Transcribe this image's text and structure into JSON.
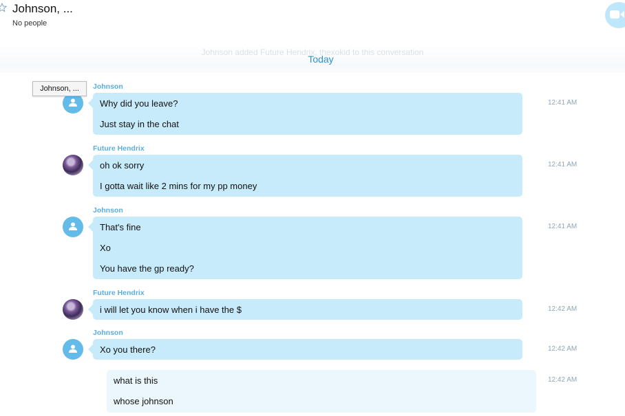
{
  "header": {
    "title": "Johnson, ...",
    "subtitle": "No people"
  },
  "system_note": "Johnson added Future Hendrix, thexokid to this conversation",
  "day_divider": "Today",
  "tooltip": "Johnson, ...",
  "messages": [
    {
      "sender": "Johnson",
      "time": "12:41 AM",
      "lines": [
        "Why did you leave?",
        "Just stay in the chat"
      ]
    },
    {
      "sender": "Future Hendrix",
      "time": "12:41 AM",
      "lines": [
        "oh ok sorry",
        "I gotta wait like 2 mins for my pp money"
      ]
    },
    {
      "sender": "Johnson",
      "time": "12:41 AM",
      "lines": [
        "That's fine",
        "Xo",
        "You have the gp ready?"
      ]
    },
    {
      "sender": "Future Hendrix",
      "time": "12:42 AM",
      "lines": [
        "i will let you know when i have the $"
      ]
    },
    {
      "sender": "Johnson",
      "time": "12:42 AM",
      "lines": [
        "Xo you there?"
      ]
    },
    {
      "sender": "",
      "time": "12:42 AM",
      "lines": [
        "what is this",
        "whose johnson"
      ]
    }
  ],
  "colors": {
    "accent": "#2e90d0",
    "sender_name": "#5aaede",
    "incoming_bubble": "#c7ebfb",
    "outgoing_bubble": "#ebf7fd",
    "avatar_default": "#62bbe8"
  },
  "icons": [
    "star-icon",
    "video-call-icon",
    "default-avatar-icon"
  ]
}
